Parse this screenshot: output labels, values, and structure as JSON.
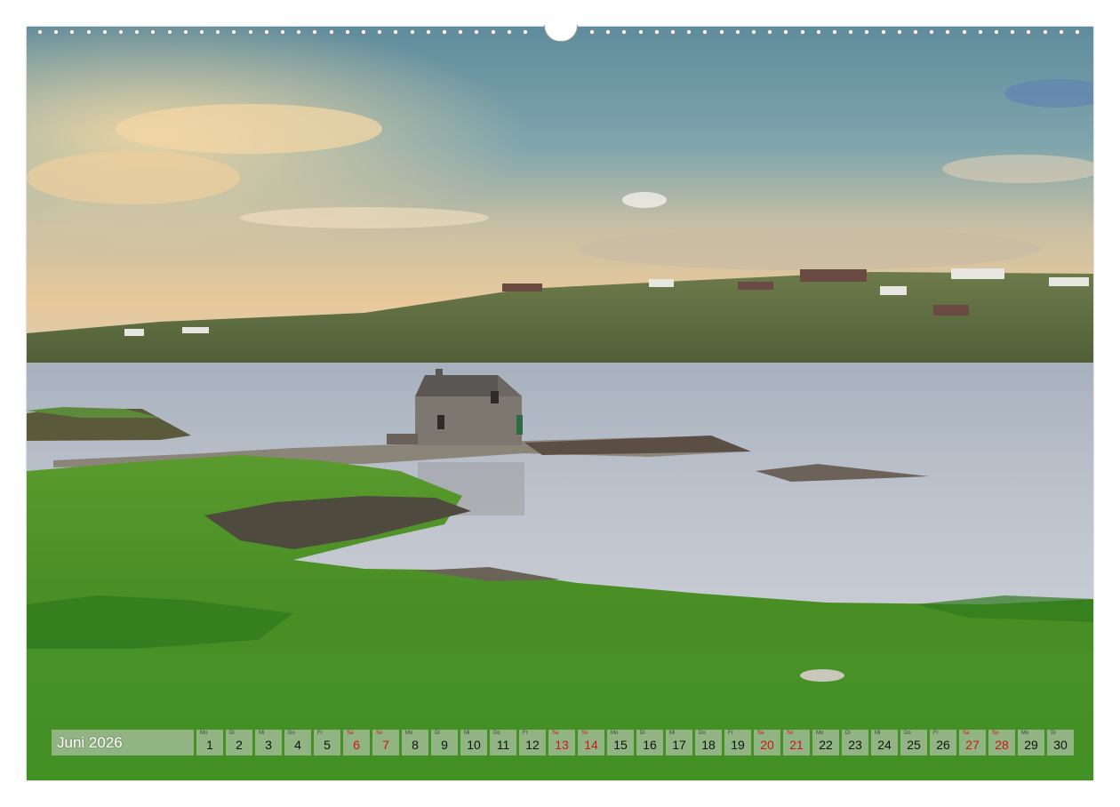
{
  "calendar": {
    "month_label": "Juni 2026",
    "days": [
      {
        "weekday": "Mo",
        "date": "1",
        "weekend": false
      },
      {
        "weekday": "Di",
        "date": "2",
        "weekend": false
      },
      {
        "weekday": "Mi",
        "date": "3",
        "weekend": false
      },
      {
        "weekday": "Do",
        "date": "4",
        "weekend": false
      },
      {
        "weekday": "Fr",
        "date": "5",
        "weekend": false
      },
      {
        "weekday": "Sa",
        "date": "6",
        "weekend": true
      },
      {
        "weekday": "So",
        "date": "7",
        "weekend": true
      },
      {
        "weekday": "Mo",
        "date": "8",
        "weekend": false
      },
      {
        "weekday": "Di",
        "date": "9",
        "weekend": false
      },
      {
        "weekday": "Mi",
        "date": "10",
        "weekend": false
      },
      {
        "weekday": "Do",
        "date": "11",
        "weekend": false
      },
      {
        "weekday": "Fr",
        "date": "12",
        "weekend": false
      },
      {
        "weekday": "Sa",
        "date": "13",
        "weekend": true
      },
      {
        "weekday": "So",
        "date": "14",
        "weekend": true
      },
      {
        "weekday": "Mo",
        "date": "15",
        "weekend": false
      },
      {
        "weekday": "Di",
        "date": "16",
        "weekend": false
      },
      {
        "weekday": "Mi",
        "date": "17",
        "weekend": false
      },
      {
        "weekday": "Do",
        "date": "18",
        "weekend": false
      },
      {
        "weekday": "Fr",
        "date": "19",
        "weekend": false
      },
      {
        "weekday": "Sa",
        "date": "20",
        "weekend": true
      },
      {
        "weekday": "So",
        "date": "21",
        "weekend": true
      },
      {
        "weekday": "Mo",
        "date": "22",
        "weekend": false
      },
      {
        "weekday": "Di",
        "date": "23",
        "weekend": false
      },
      {
        "weekday": "Mi",
        "date": "24",
        "weekend": false
      },
      {
        "weekday": "Do",
        "date": "25",
        "weekend": false
      },
      {
        "weekday": "Fr",
        "date": "26",
        "weekend": false
      },
      {
        "weekday": "Sa",
        "date": "27",
        "weekend": true
      },
      {
        "weekday": "So",
        "date": "28",
        "weekend": true
      },
      {
        "weekday": "Mo",
        "date": "29",
        "weekend": false
      },
      {
        "weekday": "Di",
        "date": "30",
        "weekend": false
      }
    ]
  },
  "colors": {
    "weekday_text": "#111111",
    "weekend_text": "#d0141c",
    "cell_background": "#d2d2d2"
  }
}
